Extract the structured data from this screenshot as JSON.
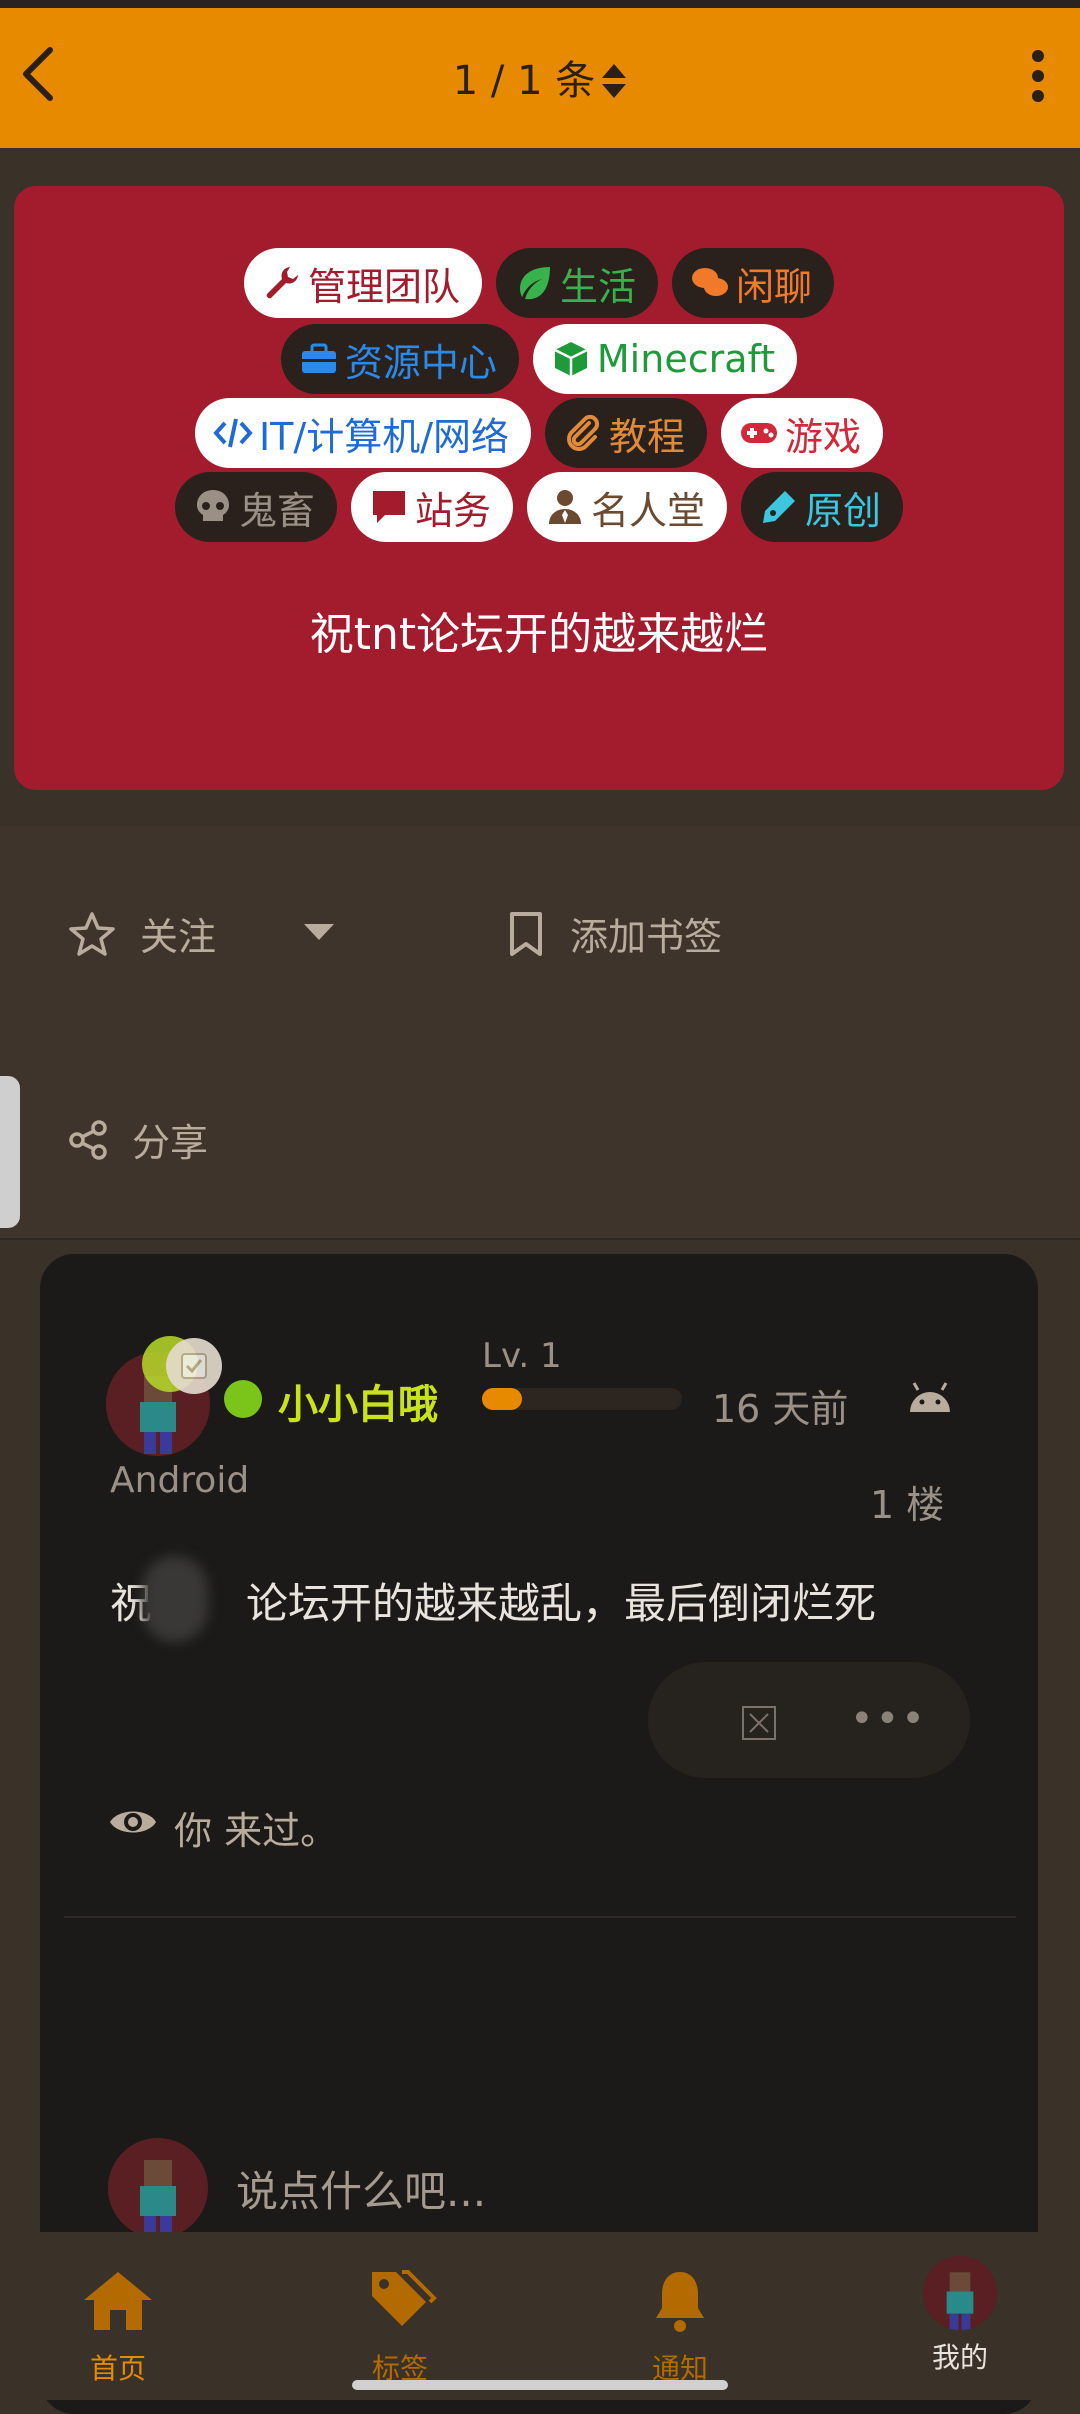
{
  "header": {
    "title": "1 / 1 条"
  },
  "tags": [
    {
      "label": "管理团队",
      "icon": "wrench-icon",
      "color": "#a31c2e",
      "style": "light"
    },
    {
      "label": "生活",
      "icon": "leaf-icon",
      "color": "#37b24d",
      "style": "dark"
    },
    {
      "label": "闲聊",
      "icon": "chat-icon",
      "color": "#f07a2a",
      "style": "dark"
    },
    {
      "label": "资源中心",
      "icon": "toolbox-icon",
      "color": "#2b8ae8",
      "style": "dark"
    },
    {
      "label": "Minecraft",
      "icon": "cube-icon",
      "color": "#1f9a3b",
      "style": "light"
    },
    {
      "label": "IT/计算机/网络",
      "icon": "code-icon",
      "color": "#1f6bd6",
      "style": "light"
    },
    {
      "label": "教程",
      "icon": "paperclip-icon",
      "color": "#e08a3a",
      "style": "dark"
    },
    {
      "label": "游戏",
      "icon": "gamepad-icon",
      "color": "#d02a3a",
      "style": "light"
    },
    {
      "label": "鬼畜",
      "icon": "skull-icon",
      "color": "#9a9086",
      "style": "dark"
    },
    {
      "label": "站务",
      "icon": "message-icon",
      "color": "#a31c2e",
      "style": "light"
    },
    {
      "label": "名人堂",
      "icon": "user-tie-icon",
      "color": "#6b4a32",
      "style": "light"
    },
    {
      "label": "原创",
      "icon": "pen-icon",
      "color": "#3cc6e0",
      "style": "dark"
    }
  ],
  "post": {
    "title": "祝tnt论坛开的越来越烂"
  },
  "actions": {
    "follow": "关注",
    "bookmark": "添加书签",
    "share": "分享"
  },
  "comment": {
    "username": "小小白哦",
    "level": "Lv. 1",
    "level_progress": 0.2,
    "time": "16 天前",
    "device": "Android",
    "floor": "1 楼",
    "text_before": "祝",
    "text_after": "论坛开的越来越乱，最后倒闭烂死",
    "more": "•••",
    "visited": "你 来过。",
    "input_placeholder": "说点什么吧..."
  },
  "nav": {
    "home": "首页",
    "tags": "标签",
    "notify": "通知",
    "me": "我的"
  },
  "colors": {
    "accent": "#e88a00",
    "card": "#a31c2e",
    "username": "#c8e31a"
  }
}
